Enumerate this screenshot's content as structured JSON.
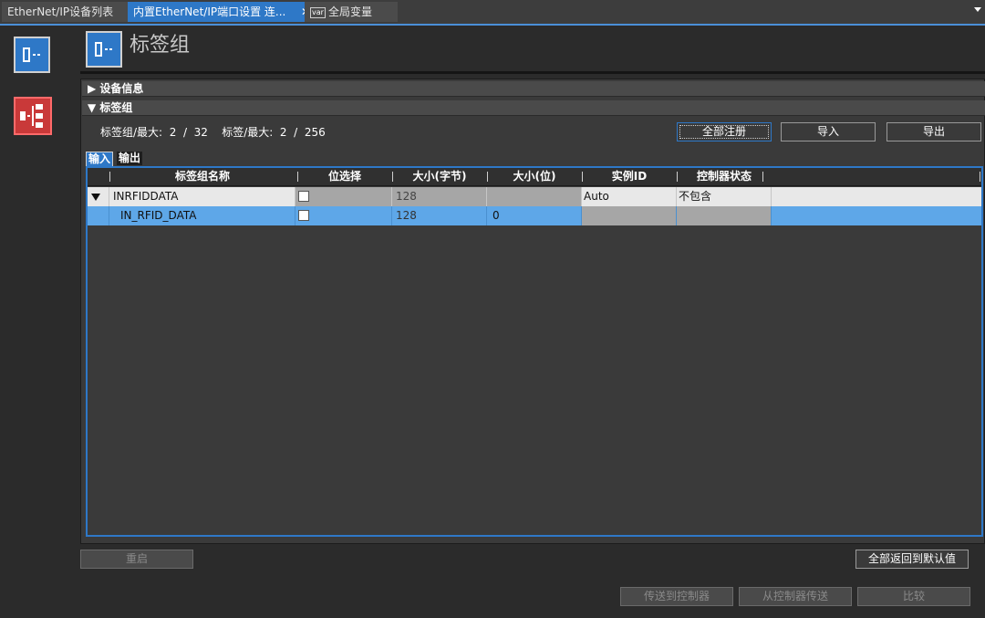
{
  "tabs": [
    {
      "label": "EtherNet/IP设备列表"
    },
    {
      "label": "内置EtherNet/IP端口设置 连...",
      "close": "✕"
    },
    {
      "badge": "var",
      "label": "全局变量"
    }
  ],
  "sidebar": {
    "items": [
      {
        "icon": "device-module-icon"
      },
      {
        "icon": "network-tree-icon"
      }
    ]
  },
  "header": {
    "icon": "device-module-icon",
    "title": "标签组"
  },
  "sections": {
    "device_info": "▶ 设备信息",
    "tag_group": "▼ 标签组"
  },
  "counts": {
    "tag_groups": "标签组/最大:  2  /  32",
    "tags": "标签/最大:  2  /  256"
  },
  "buttons": {
    "register_all": "全部注册",
    "import": "导入",
    "export": "导出",
    "restart": "重启",
    "reset_defaults": "全部返回到默认值",
    "send_to_controller": "传送到控制器",
    "receive_from_controller": "从控制器传送",
    "compare": "比较"
  },
  "subtabs": {
    "input": "输入",
    "output": "输出"
  },
  "table": {
    "columns": [
      "标签组名称",
      "位选择",
      "大小(字节)",
      "大小(位)",
      "实例ID",
      "控制器状态"
    ],
    "rows": [
      {
        "name": "INRFIDDATA",
        "size_bytes": "128",
        "size_bits": "",
        "instance_id": "Auto",
        "controller_status": "不包含"
      },
      {
        "name": "IN_RFID_DATA",
        "size_bytes": "128",
        "size_bits": "0",
        "instance_id": "",
        "controller_status": ""
      }
    ]
  }
}
